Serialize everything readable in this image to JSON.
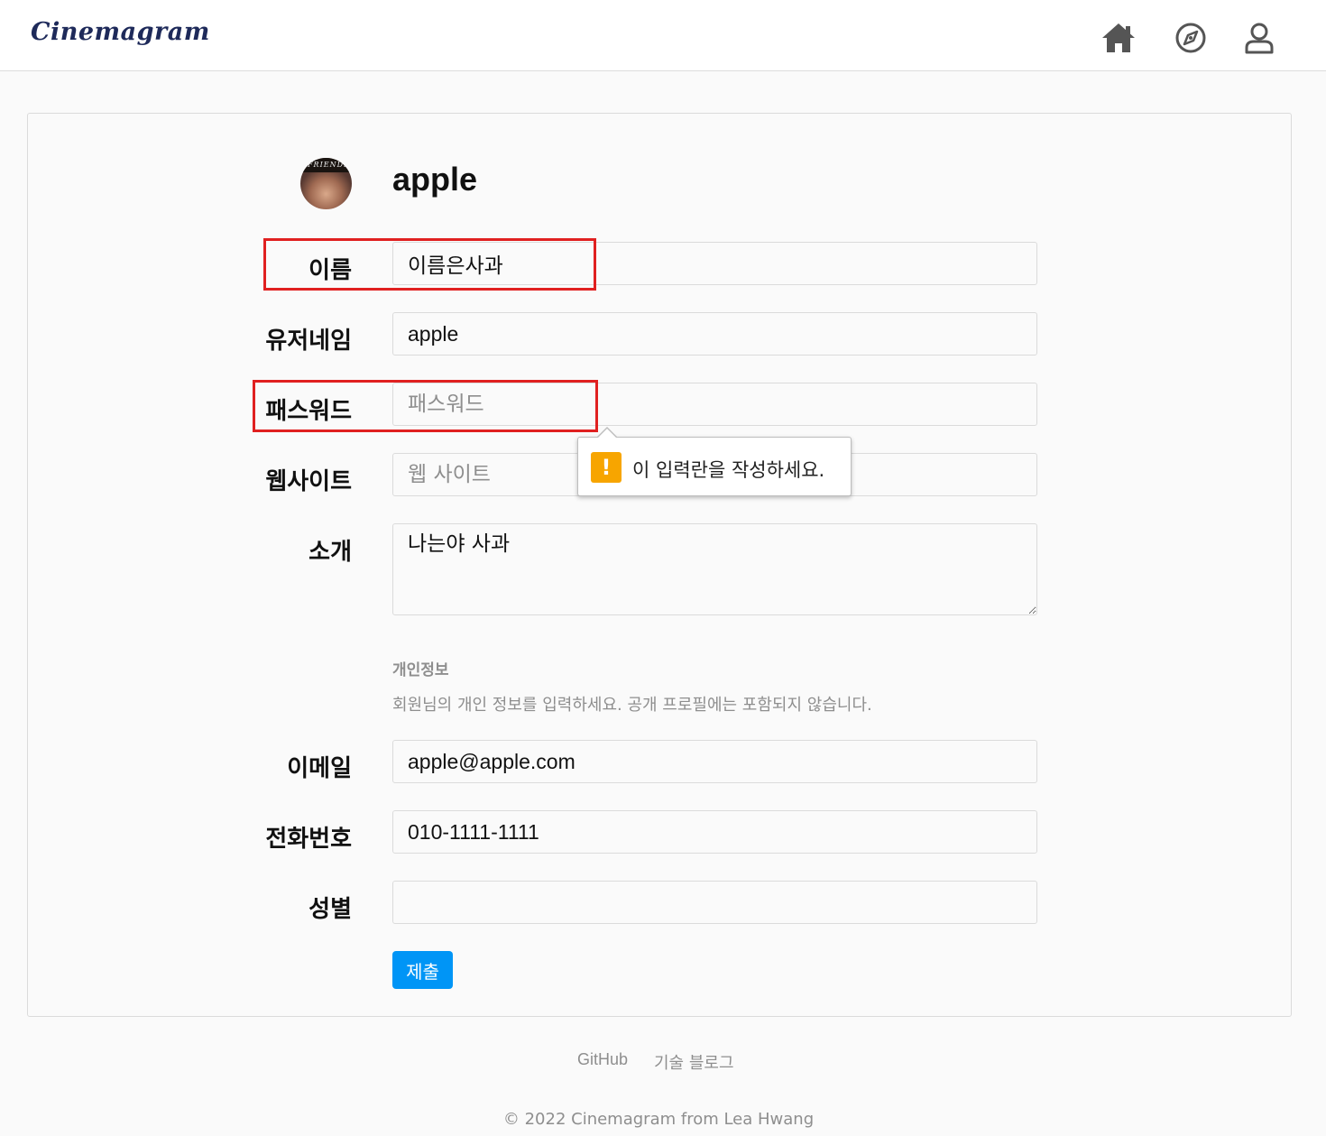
{
  "header": {
    "logo": "Cinemagram",
    "icons": [
      "home-icon",
      "compass-icon",
      "user-icon"
    ]
  },
  "profile": {
    "username": "apple"
  },
  "form": {
    "name_label": "이름",
    "name_value": "이름은사과",
    "username_label": "유저네임",
    "username_value": "apple",
    "password_label": "패스워드",
    "password_placeholder": "패스워드",
    "website_label": "웹사이트",
    "website_placeholder": "웹 사이트",
    "bio_label": "소개",
    "bio_value": "나는야 사과",
    "private_title": "개인정보",
    "private_desc": "회원님의 개인 정보를 입력하세요. 공개 프로필에는 포함되지 않습니다.",
    "email_label": "이메일",
    "email_value": "apple@apple.com",
    "phone_label": "전화번호",
    "phone_value": "010-1111-1111",
    "gender_label": "성별",
    "gender_value": "",
    "submit_label": "제출"
  },
  "tooltip": {
    "icon": "!",
    "text": "이 입력란을 작성하세요."
  },
  "footer": {
    "github": "GitHub",
    "blog": "기술 블로그",
    "copyright": "© 2022 Cinemagram from Lea Hwang"
  },
  "colors": {
    "accent": "#0095f6",
    "highlight": "#e02020",
    "warning": "#f7a500"
  }
}
